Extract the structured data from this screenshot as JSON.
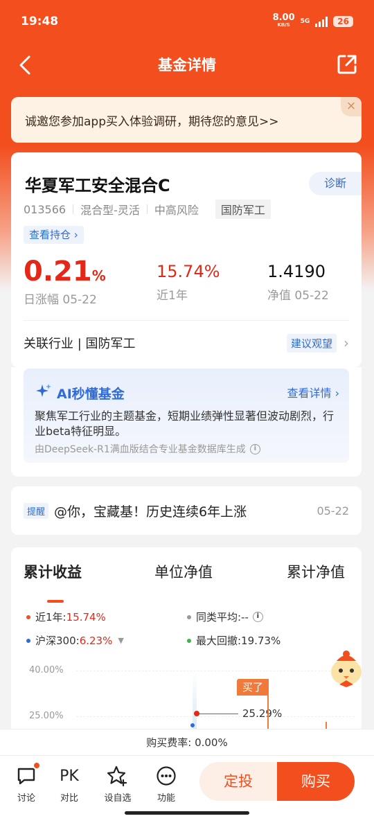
{
  "status_bar": {
    "time": "19:48",
    "net_speed": "8.00",
    "net_unit": "KB/S",
    "network": "5G",
    "battery": "26"
  },
  "nav": {
    "title": "基金详情"
  },
  "survey": {
    "text": "诚邀您参加app买入体验调研，期待您的意见>>",
    "close": "×"
  },
  "fund": {
    "name": "华夏军工安全混合C",
    "diagnose_label": "诊断",
    "code": "013566",
    "type": "混合型-灵活",
    "risk": "中高风险",
    "sector_tag": "国防军工",
    "holdings_link": "查看持仓 ›",
    "daily_change_value": "0.21",
    "daily_change_unit": "%",
    "daily_change_label": "日涨幅 05-22",
    "yearly_return": "15.74%",
    "yearly_return_label": "近1年",
    "nav_value": "1.4190",
    "nav_label": "净值 05-22",
    "industry_label": "关联行业 | 国防军工",
    "industry_advice": "建议观望"
  },
  "ai": {
    "title": "AI秒懂基金",
    "detail_link": "查看详情 ›",
    "summary": "聚焦军工行业的主题基金，短期业绩弹性显著但波动剧烈，行业beta特征明显。",
    "source": "由DeepSeek-R1满血版结合专业基金数据库生成"
  },
  "reminder": {
    "tag": "提醒",
    "text": "@你，宝藏基！历史连续6年上涨",
    "date": "05-22"
  },
  "chart": {
    "tabs": [
      "累计收益",
      "单位净值",
      "累计净值"
    ],
    "legend": {
      "fund_label": "近1年:",
      "fund_value": "15.74%",
      "peer_label": "同类平均:--",
      "index_label": "沪深300:",
      "index_value": "6.23%",
      "drawdown_label": "最大回撤:19.73%"
    },
    "buy_tag": "买了",
    "marker_value": "25.29%",
    "colors": {
      "fund": "#e8542a",
      "peer": "#999999",
      "index": "#2f6bd8",
      "drawdown": "#3cb44b"
    }
  },
  "chart_data": {
    "type": "line",
    "title": "累计收益",
    "y_ticks": [
      "40.00%",
      "25.00%"
    ],
    "series": [
      {
        "name": "近1年",
        "final_value": "15.74%"
      },
      {
        "name": "沪深300",
        "final_value": "6.23%"
      }
    ],
    "annotations": [
      "25.29%",
      "买了"
    ]
  },
  "fee": {
    "text": "购买费率: 0.00%"
  },
  "bottom_bar": {
    "discuss": "讨论",
    "compare_icon_text": "PK",
    "compare": "对比",
    "watchlist": "设自选",
    "functions": "功能",
    "sip_button": "定投",
    "buy_button": "购买"
  }
}
